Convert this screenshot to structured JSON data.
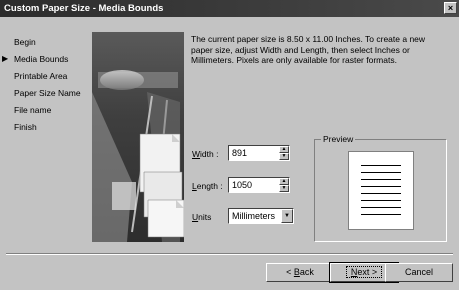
{
  "window": {
    "title": "Custom Paper Size - Media Bounds",
    "close_glyph": "×"
  },
  "nav": {
    "items": [
      {
        "label": "Begin",
        "active": false
      },
      {
        "label": "Media Bounds",
        "active": true
      },
      {
        "label": "Printable Area",
        "active": false
      },
      {
        "label": "Paper Size Name",
        "active": false
      },
      {
        "label": "File name",
        "active": false
      },
      {
        "label": "Finish",
        "active": false
      }
    ],
    "current_marker": "▶"
  },
  "description": "The current paper size is 8.50 x 11.00 Inches. To create a new paper size, adjust Width and Length, then select Inches or Millimeters. Pixels are only available for raster formats.",
  "form": {
    "width": {
      "accel": "W",
      "rest": "idth :",
      "value": "891"
    },
    "length": {
      "accel": "L",
      "rest": "ength :",
      "value": "1050"
    },
    "units": {
      "accel": "U",
      "rest": "nits",
      "value": "Millimeters"
    }
  },
  "preview": {
    "legend": "Preview"
  },
  "buttons": {
    "back": {
      "pre": "< ",
      "accel": "B",
      "rest": "ack"
    },
    "next": {
      "accel": "N",
      "rest": "ext >"
    },
    "cancel": "Cancel"
  },
  "colors": {
    "face": "#c3c3c3",
    "titlebar": "#333333"
  }
}
